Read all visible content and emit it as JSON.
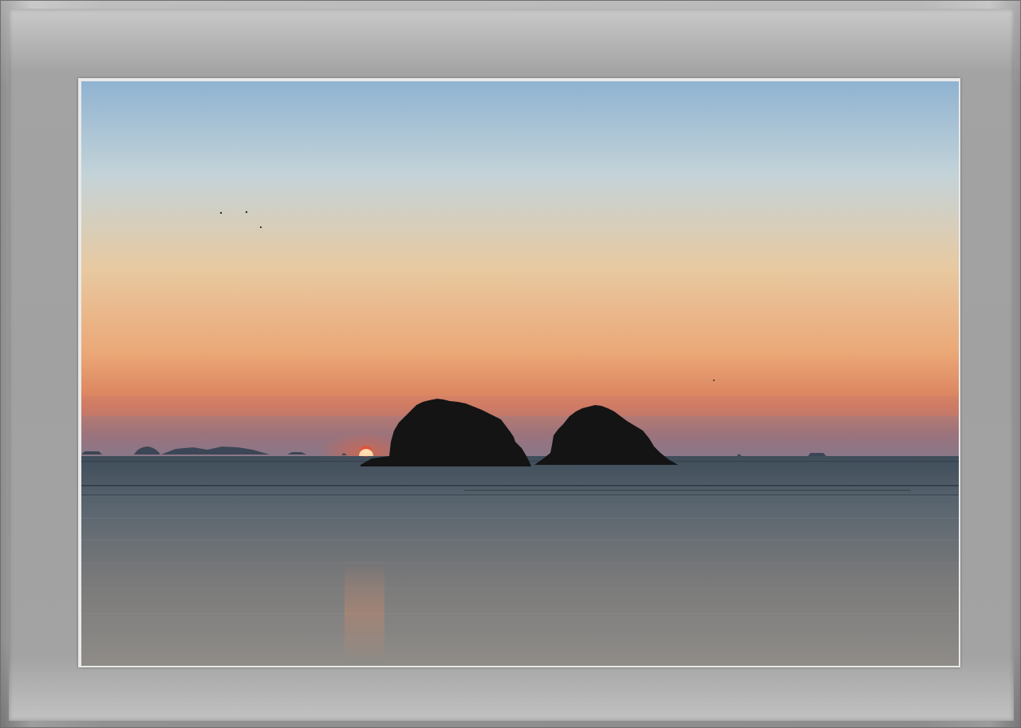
{
  "image": {
    "subject": "sunset-over-sea-with-two-islands",
    "colors": {
      "sky_top": "#8fb3d1",
      "sky_mid": "#e8c9a0",
      "sky_horizon": "#d97e5c",
      "haze_band": "#9a7a86",
      "sun": "#ff2a12",
      "sun_core": "#ffe6a8",
      "sea_top": "#4c5a66",
      "sea_bottom": "#8f8c88",
      "silhouette": "#141414",
      "mat": "#a3a3a3",
      "border": "#e9e9e9"
    }
  }
}
